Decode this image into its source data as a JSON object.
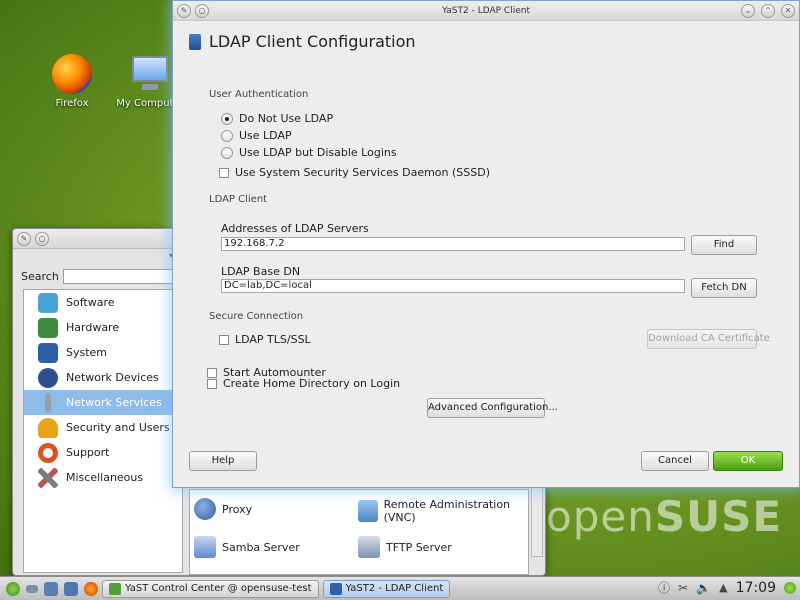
{
  "desktop": {
    "icons": [
      {
        "label": "Firefox"
      },
      {
        "label": "My Computer"
      }
    ],
    "wordmark_open": "open",
    "wordmark_suse": "SUSE"
  },
  "control_center": {
    "search_label": "Search",
    "categories": [
      {
        "label": "Software",
        "icon": "software-icon",
        "color": "#4aa3d6"
      },
      {
        "label": "Hardware",
        "icon": "hardware-icon",
        "color": "#3d8a3d"
      },
      {
        "label": "System",
        "icon": "system-icon",
        "color": "#2d5fa8"
      },
      {
        "label": "Network Devices",
        "icon": "network-devices-icon",
        "color": "#2f4f8f"
      },
      {
        "label": "Network Services",
        "icon": "network-services-icon",
        "color": "#9aa0a8"
      },
      {
        "label": "Security and Users",
        "icon": "security-icon",
        "color": "#e8a317"
      },
      {
        "label": "Support",
        "icon": "support-icon",
        "color": "#d9541e"
      },
      {
        "label": "Miscellaneous",
        "icon": "misc-icon",
        "color": "#7c7c7c"
      }
    ],
    "modules": [
      {
        "label": "Proxy",
        "icon": "proxy-icon",
        "color": "#2c5d9e"
      },
      {
        "label": "Remote Administration (VNC)",
        "icon": "vnc-icon",
        "color": "#4f86c6"
      },
      {
        "label": "Samba Server",
        "icon": "samba-icon",
        "color": "#5b8bd0"
      },
      {
        "label": "TFTP Server",
        "icon": "tftp-icon",
        "color": "#7a93b0"
      }
    ]
  },
  "dialog": {
    "window_title": "YaST2 - LDAP Client",
    "heading": "LDAP Client Configuration",
    "user_auth": {
      "title": "User Authentication",
      "options": [
        "Do Not Use LDAP",
        "Use LDAP",
        "Use LDAP but Disable Logins"
      ],
      "selected_index": 0,
      "sssd_label": "Use System Security Services Daemon (SSSD)",
      "sssd_checked": false
    },
    "ldap_client": {
      "title": "LDAP Client",
      "servers_label": "Addresses of LDAP Servers",
      "servers_value": "192.168.7.2",
      "find_label": "Find",
      "base_dn_label": "LDAP Base DN",
      "base_dn_value": "DC=lab,DC=local",
      "fetch_label": "Fetch DN"
    },
    "secure": {
      "title": "Secure Connection",
      "tls_label": "LDAP TLS/SSL",
      "tls_checked": false,
      "download_label": "Download CA Certificate"
    },
    "automounter_label": "Start Automounter",
    "home_dir_label": "Create Home Directory on Login",
    "advanced_label": "Advanced Configuration...",
    "help_label": "Help",
    "cancel_label": "Cancel",
    "ok_label": "OK"
  },
  "taskbar": {
    "tasks": [
      {
        "label": "YaST Control Center @ opensuse-test",
        "active": false
      },
      {
        "label": "YaST2 - LDAP Client",
        "active": true
      }
    ],
    "clock": "17:09"
  }
}
